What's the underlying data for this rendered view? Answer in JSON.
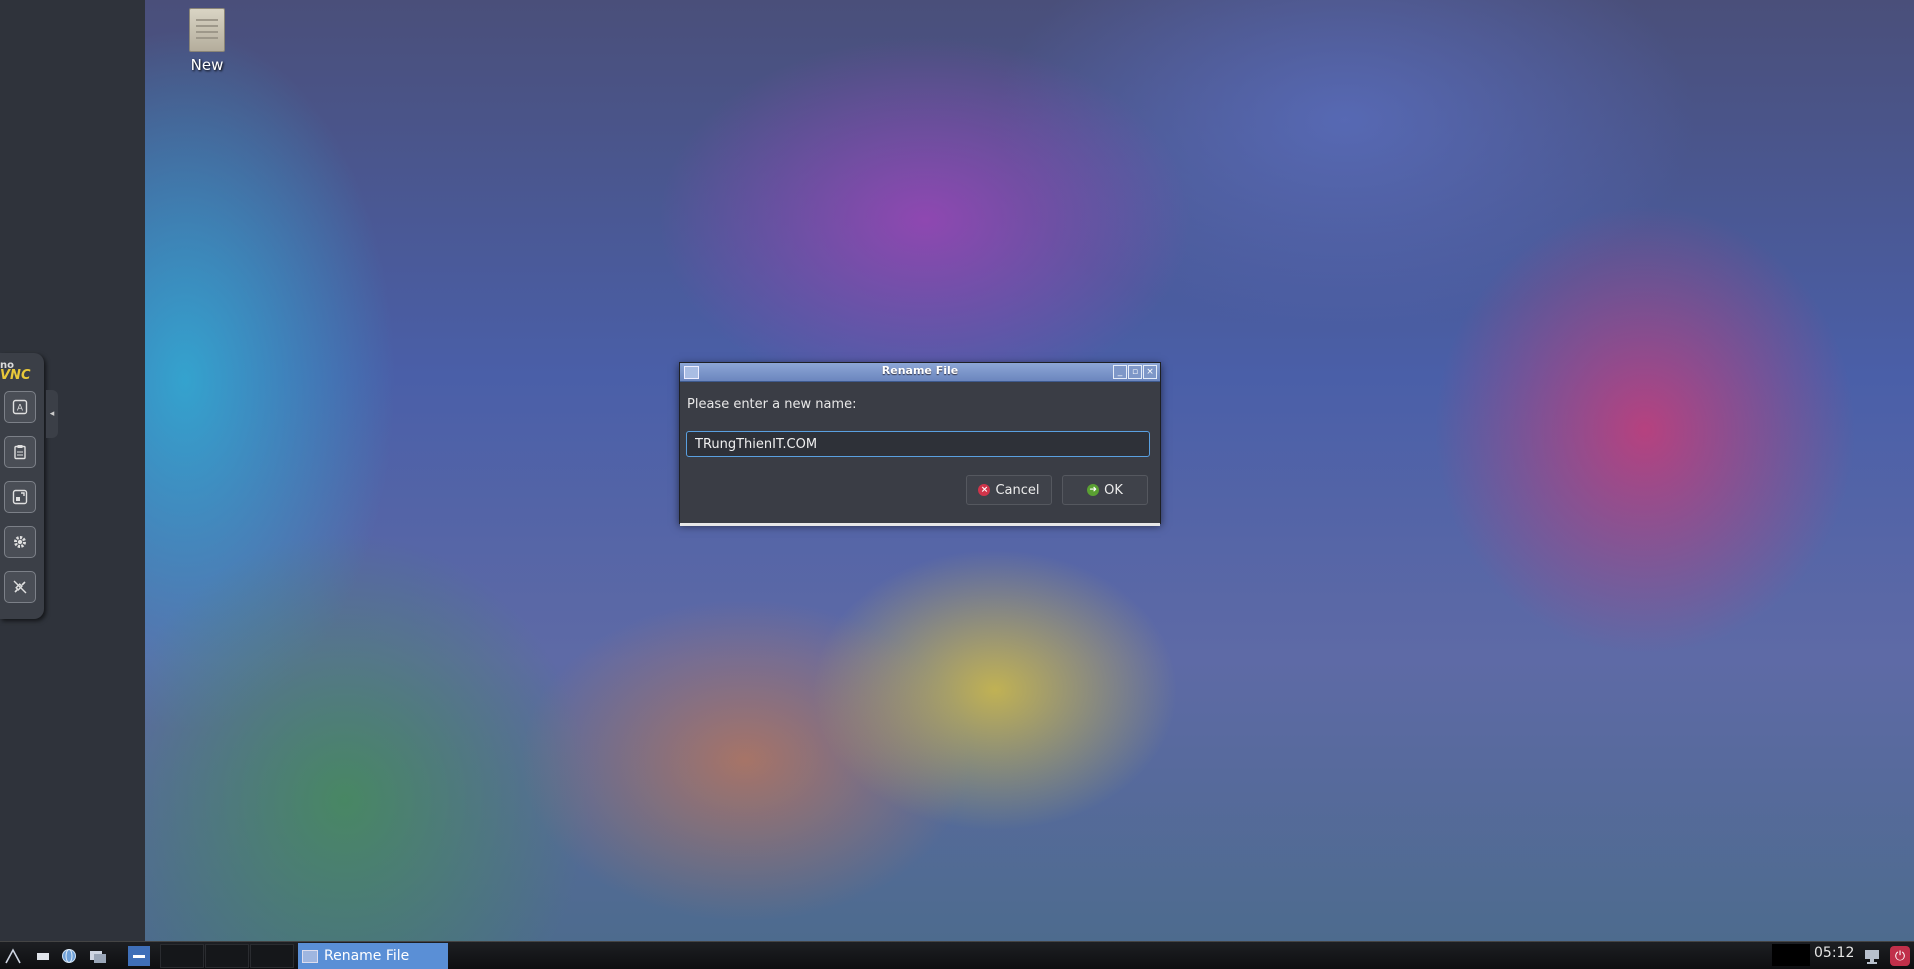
{
  "desktop": {
    "icon_label": "New"
  },
  "vnc_panel": {
    "logo_top": "no",
    "logo_bottom": "VNC",
    "buttons": [
      "keyboard-icon",
      "clipboard-icon",
      "fullscreen-icon",
      "settings-icon",
      "disconnect-icon"
    ],
    "handle_glyph": "◂"
  },
  "dialog": {
    "title": "Rename File",
    "prompt": "Please enter a new name:",
    "input_value": "TRungThienIT.COM",
    "cancel_label": "Cancel",
    "ok_label": "OK",
    "title_buttons": [
      "minimize",
      "maximize",
      "close"
    ]
  },
  "taskbar": {
    "task_label": "Rename File",
    "clock": "05:12",
    "accent": "#5a8fd6",
    "power_color": "#c0304a"
  }
}
